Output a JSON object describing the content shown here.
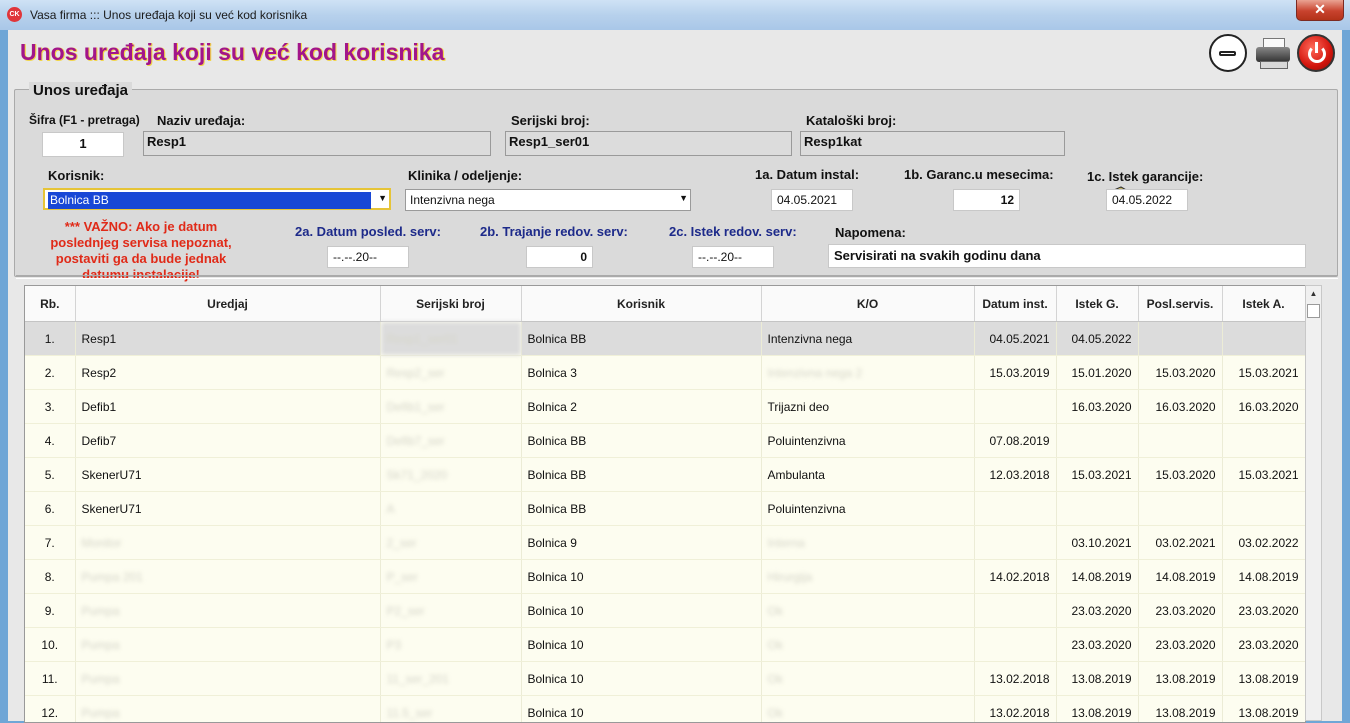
{
  "window": {
    "title": "Vasa firma ::: Unos uređaja koji su već kod korisnika",
    "app_icon": "CK",
    "close_glyph": "✕"
  },
  "page_title": "Unos uređaja koji su već kod korisnika",
  "form": {
    "group_title": "Unos uređaja",
    "sifra": {
      "label": "Šifra (F1 - pretraga)",
      "value": "1"
    },
    "naziv": {
      "label": "Naziv uređaja:",
      "value": "Resp1"
    },
    "serijski": {
      "label": "Serijski broj:",
      "value": "Resp1_ser01"
    },
    "kataloski": {
      "label": "Kataloški broj:",
      "value": "Resp1kat"
    },
    "korisnik": {
      "label": "Korisnik:",
      "value": "Bolnica BB"
    },
    "klinika": {
      "label": "Klinika / odeljenje:",
      "value": "Intenzivna nega"
    },
    "datum_instal": {
      "label": "1a. Datum instal:",
      "value": "04.05.2021"
    },
    "garanc": {
      "label": "1b. Garanc.u mesecima:",
      "value": "12"
    },
    "istek_garancije": {
      "label": "1c. Istek garancije:",
      "value": "04.05.2022"
    },
    "warning": "*** VAŽNO: Ako je datum poslednjeg servisa nepoznat, postaviti ga da bude jednak datumu instalacije!",
    "datum_posled": {
      "label": "2a. Datum posled. serv:",
      "value": "--.--.20--"
    },
    "trajanje": {
      "label": "2b. Trajanje redov. serv:",
      "value": "0"
    },
    "istek_redov": {
      "label": "2c. Istek redov. serv:",
      "value": "--.--.20--"
    },
    "napomena": {
      "label": "Napomena:",
      "value": "Servisirati na svakih godinu dana"
    }
  },
  "grid": {
    "columns": [
      "Rb.",
      "Uredjaj",
      "Serijski broj",
      "Korisnik",
      "K/O",
      "Datum inst.",
      "Istek G.",
      "Posl.servis.",
      "Istek A."
    ],
    "rows": [
      {
        "rb": "1.",
        "uredjaj": "Resp1",
        "serijski": "Resp1_ser01",
        "korisnik": "Bolnica BB",
        "ko": "Intenzivna nega",
        "datum": "04.05.2021",
        "istek_g": "04.05.2022",
        "posl": "",
        "istek_a": "",
        "selected": true
      },
      {
        "rb": "2.",
        "uredjaj": "Resp2",
        "serijski": "Resp2_ser",
        "korisnik": "Bolnica 3",
        "ko": "Intenzivna nega 2",
        "datum": "15.03.2019",
        "istek_g": "15.01.2020",
        "posl": "15.03.2020",
        "istek_a": "15.03.2021"
      },
      {
        "rb": "3.",
        "uredjaj": "Defib1",
        "serijski": "Defib1_ser",
        "korisnik": "Bolnica 2",
        "ko": "Trijazni deo",
        "datum": "",
        "istek_g": "16.03.2020",
        "posl": "16.03.2020",
        "istek_a": "16.03.2020"
      },
      {
        "rb": "4.",
        "uredjaj": "Defib7",
        "serijski": "Defib7_ser",
        "korisnik": "Bolnica BB",
        "ko": "Poluintenzivna",
        "datum": "07.08.2019",
        "istek_g": "",
        "posl": "",
        "istek_a": ""
      },
      {
        "rb": "5.",
        "uredjaj": "SkenerU71",
        "serijski": "Sk71_2020",
        "korisnik": "Bolnica BB",
        "ko": "Ambulanta",
        "datum": "12.03.2018",
        "istek_g": "15.03.2021",
        "posl": "15.03.2020",
        "istek_a": "15.03.2021"
      },
      {
        "rb": "6.",
        "uredjaj": "SkenerU71",
        "serijski": "A",
        "korisnik": "Bolnica BB",
        "ko": "Poluintenzivna",
        "datum": "",
        "istek_g": "",
        "posl": "",
        "istek_a": ""
      },
      {
        "rb": "7.",
        "uredjaj": "Monitor",
        "serijski": "2_ser",
        "korisnik": "Bolnica 9",
        "ko": "Interna",
        "datum": "",
        "istek_g": "03.10.2021",
        "posl": "03.02.2021",
        "istek_a": "03.02.2022"
      },
      {
        "rb": "8.",
        "uredjaj": "Pumpa 201",
        "serijski": "P_ser",
        "korisnik": "Bolnica 10",
        "ko": "Hirurgija",
        "datum": "14.02.2018",
        "istek_g": "14.08.2019",
        "posl": "14.08.2019",
        "istek_a": "14.08.2019"
      },
      {
        "rb": "9.",
        "uredjaj": "Pumpa",
        "serijski": "P2_ser",
        "korisnik": "Bolnica 10",
        "ko": "Ok",
        "datum": "",
        "istek_g": "23.03.2020",
        "posl": "23.03.2020",
        "istek_a": "23.03.2020"
      },
      {
        "rb": "10.",
        "uredjaj": "Pumpa",
        "serijski": "P3",
        "korisnik": "Bolnica 10",
        "ko": "Ok",
        "datum": "",
        "istek_g": "23.03.2020",
        "posl": "23.03.2020",
        "istek_a": "23.03.2020"
      },
      {
        "rb": "11.",
        "uredjaj": "Pumpa",
        "serijski": "11_ser_201",
        "korisnik": "Bolnica 10",
        "ko": "Ok",
        "datum": "13.02.2018",
        "istek_g": "13.08.2019",
        "posl": "13.08.2019",
        "istek_a": "13.08.2019"
      },
      {
        "rb": "12.",
        "uredjaj": "Pumpa",
        "serijski": "11.5_ser",
        "korisnik": "Bolnica 10",
        "ko": "Ok",
        "datum": "13.02.2018",
        "istek_g": "13.08.2019",
        "posl": "13.08.2019",
        "istek_a": "13.08.2019"
      }
    ]
  },
  "icons": [
    "app-icon",
    "minimize-icon",
    "printer-icon",
    "power-icon",
    "book-search-icon"
  ],
  "colors": {
    "title": "#a2158a",
    "warning": "#e02a18",
    "label_blue": "#1d2a8a",
    "selection": "#1847d6"
  }
}
